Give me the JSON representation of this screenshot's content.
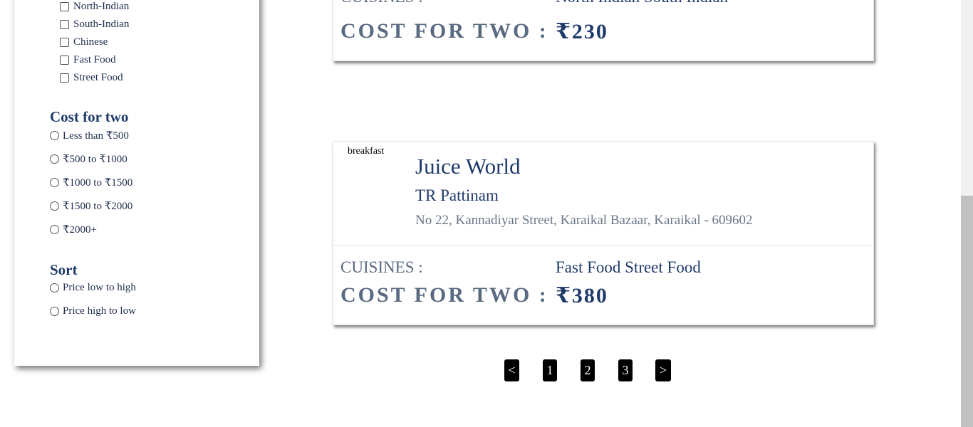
{
  "filters": {
    "cuisines": [
      {
        "label": "North-Indian",
        "checked": false
      },
      {
        "label": "South-Indian",
        "checked": false
      },
      {
        "label": "Chinese",
        "checked": false
      },
      {
        "label": "Fast Food",
        "checked": false
      },
      {
        "label": "Street Food",
        "checked": false
      }
    ],
    "cost_title": "Cost for two",
    "cost_options": [
      "Less than ₹500",
      "₹500 to ₹1000",
      "₹1000 to ₹1500",
      "₹1500 to ₹2000",
      "₹2000+"
    ],
    "sort_title": "Sort",
    "sort_options": [
      "Price low to high",
      "Price high to low"
    ]
  },
  "restaurants": [
    {
      "cuisines_label": "CUISINES :",
      "cuisines": "North Indian South Indian",
      "cost_label": "COST FOR TWO :",
      "cost": "₹230"
    },
    {
      "tag": "breakfast",
      "name": "Juice World",
      "area": "TR Pattinam",
      "address": "No 22, Kannadiyar Street, Karaikal Bazaar, Karaikal - 609602",
      "cuisines_label": "CUISINES :",
      "cuisines": "Fast Food Street Food",
      "cost_label": "COST FOR TWO :",
      "cost": "₹380"
    }
  ],
  "pagination": {
    "prev": "<",
    "pages": [
      "1",
      "2",
      "3"
    ],
    "next": ">"
  }
}
